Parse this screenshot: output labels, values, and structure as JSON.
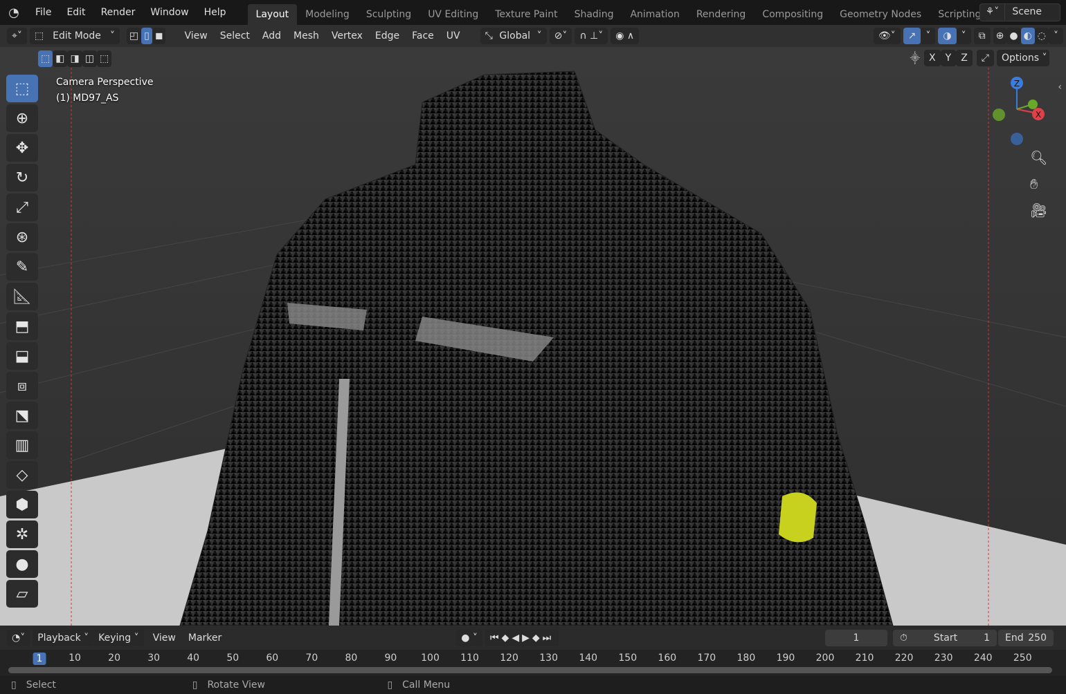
{
  "topbar": {
    "menus": [
      "File",
      "Edit",
      "Render",
      "Window",
      "Help"
    ],
    "workspaces": [
      "Layout",
      "Modeling",
      "Sculpting",
      "UV Editing",
      "Texture Paint",
      "Shading",
      "Animation",
      "Rendering",
      "Compositing",
      "Geometry Nodes",
      "Scripting"
    ],
    "active_workspace": "Layout",
    "add_tab": "+",
    "scene": "Scene"
  },
  "header": {
    "mode": "Edit Mode",
    "menus": [
      "View",
      "Select",
      "Add",
      "Mesh",
      "Vertex",
      "Edge",
      "Face",
      "UV"
    ],
    "orientation": "Global",
    "axes": [
      "X",
      "Y",
      "Z"
    ],
    "options": "Options",
    "select_mode_active": "edge"
  },
  "viewport": {
    "title": "Camera Perspective",
    "object": "(1) MD97_AS",
    "selection_color": "#c8d21e",
    "accent": "#4772b3",
    "gizmo": {
      "x": "X",
      "y": "Y",
      "z": "Z"
    }
  },
  "timeline": {
    "menus": [
      "Playback",
      "Keying",
      "View",
      "Marker"
    ],
    "current_frame": "1",
    "start_label": "Start",
    "start": "1",
    "end_label": "End",
    "end": "250",
    "ticks": [
      "1",
      "10",
      "20",
      "30",
      "40",
      "50",
      "60",
      "70",
      "80",
      "90",
      "100",
      "110",
      "120",
      "130",
      "140",
      "150",
      "160",
      "170",
      "180",
      "190",
      "200",
      "210",
      "220",
      "230",
      "240",
      "250"
    ]
  },
  "status": {
    "items": [
      "Select",
      "Rotate View",
      "Call Menu"
    ]
  }
}
